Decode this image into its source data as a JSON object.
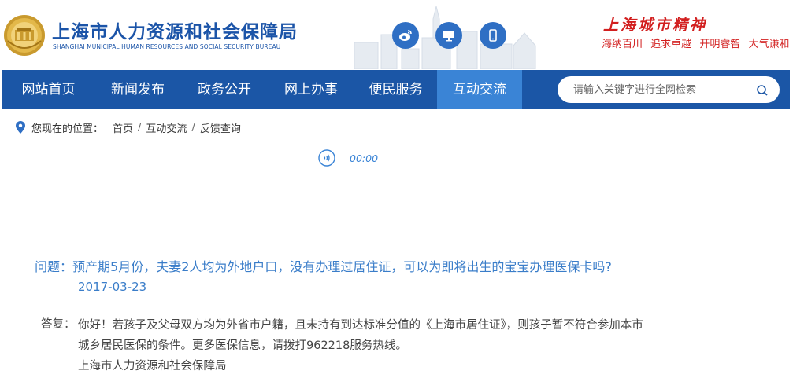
{
  "header": {
    "cn_title": "上海市人力资源和社会保障局",
    "en_title": "SHANGHAI MUNICIPAL HUMAN RESOURCES AND SOCIAL SECURITY BUREAU",
    "logo_icon": "bureau-emblem-icon",
    "social_icons": [
      "weibo-icon",
      "desktop-icon",
      "mobile-icon"
    ],
    "slogan": "上海城市精神",
    "slogan_items": [
      "海纳百川",
      "追求卓越",
      "开明睿智",
      "大气谦和"
    ]
  },
  "nav": {
    "items": [
      {
        "label": "网站首页"
      },
      {
        "label": "新闻发布"
      },
      {
        "label": "政务公开"
      },
      {
        "label": "网上办事"
      },
      {
        "label": "便民服务"
      },
      {
        "label": "互动交流",
        "active": true
      }
    ],
    "search_placeholder": "请输入关键字进行全网检索"
  },
  "breadcrumb": {
    "label": "您现在的位置：",
    "items": [
      "首页",
      "互动交流",
      "反馈查询"
    ]
  },
  "audio": {
    "time": "00:00"
  },
  "question": {
    "label": "问题：",
    "text": "预产期5月份，夫妻2人均为外地户口，没有办理过居住证，可以为即将出生的宝宝办理医保卡吗?",
    "date": "2017-03-23"
  },
  "answer": {
    "label": "答复：",
    "lines": [
      "你好！若孩子及父母双方均为外省市户籍，且未持有到达标准分值的《上海市居住证》，则孩子暂不符合参加本市",
      "城乡居民医保的条件。更多医保信息，请拨打962218服务热线。",
      "上海市人力资源和社会保障局"
    ]
  },
  "colors": {
    "brand_blue": "#1b56a6",
    "active_tab": "#3a84d6",
    "slogan_red": "#d21f1f",
    "link_blue": "#3a7dc9"
  }
}
